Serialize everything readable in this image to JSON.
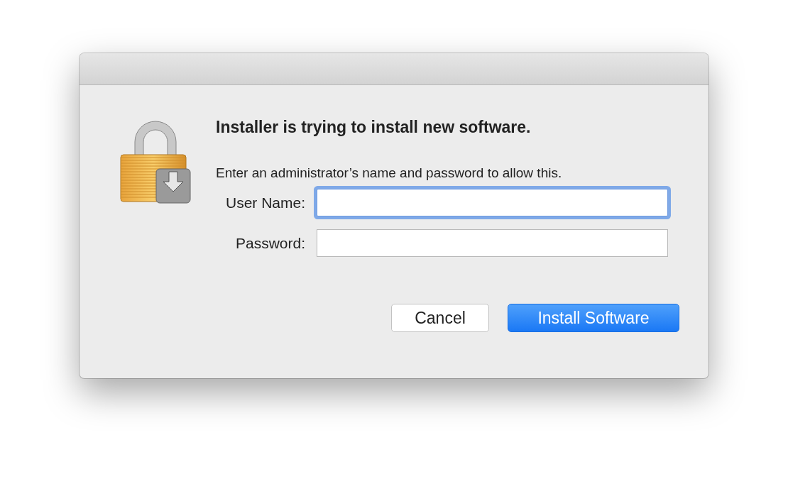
{
  "dialog": {
    "heading": "Installer is trying to install new software.",
    "message": "Enter an administrator’s name and password to allow this.",
    "fields": [
      {
        "label": "User Name:",
        "focused": true
      },
      {
        "label": "Password:",
        "focused": false
      }
    ],
    "buttons": [
      {
        "label": "Cancel",
        "default": false
      },
      {
        "label": "Install Software",
        "default": true
      }
    ]
  }
}
